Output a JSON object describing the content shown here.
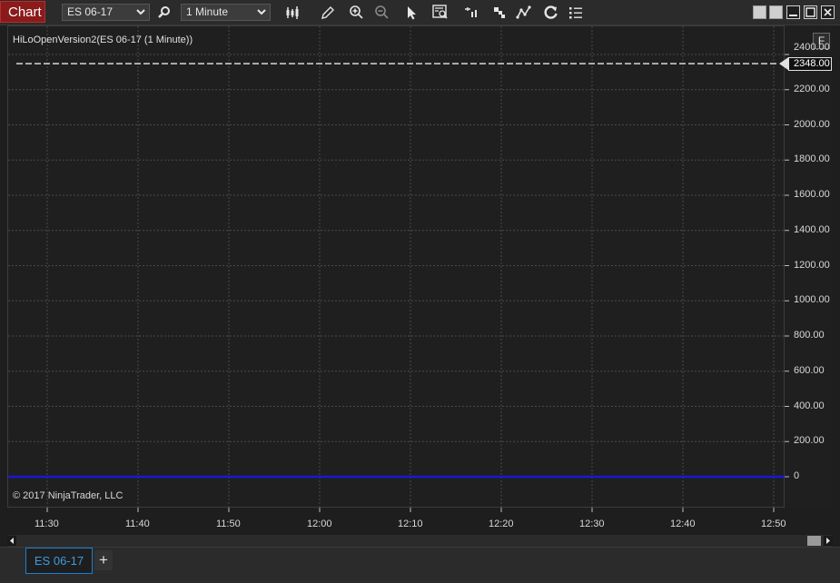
{
  "toolbar": {
    "chart_label": "Chart",
    "instrument": "ES 06-17",
    "interval": "1 Minute",
    "icons": [
      "magnifier-icon",
      "bars-type-icon",
      "pencil-icon",
      "zoom-in-icon",
      "zoom-out-icon",
      "pointer-icon",
      "data-box-icon",
      "bar-spacing-icon",
      "chart-style-icon",
      "strategy-icon",
      "reload-icon",
      "properties-list-icon"
    ]
  },
  "window_controls": [
    "tile-button",
    "tile-button-2",
    "minimize-button",
    "maximize-button",
    "close-button"
  ],
  "chart": {
    "indicator_label": "HiLoOpenVersion2(ES 06-17 (1 Minute))",
    "copyright": "© 2017 NinjaTrader, LLC",
    "f_button": "F",
    "price_marker": "2348.00",
    "colors": {
      "background": "#1f1f1f",
      "grid": "#4a4a4a",
      "zero_line": "#1818d8",
      "price_line": "#e8e8e8"
    }
  },
  "chart_data": {
    "type": "line",
    "y_ticks": [
      "2400.00",
      "2200.00",
      "2000.00",
      "1800.00",
      "1600.00",
      "1400.00",
      "1200.00",
      "1000.00",
      "800.00",
      "600.00",
      "400.00",
      "200.00",
      "0"
    ],
    "x_ticks": [
      "11:30",
      "11:40",
      "11:50",
      "12:00",
      "12:10",
      "12:20",
      "12:30",
      "12:40",
      "12:50"
    ],
    "ylim": [
      0,
      2400
    ],
    "series": [
      {
        "values": [
          2348,
          2348
        ]
      },
      {
        "values": [
          0,
          0
        ]
      }
    ]
  },
  "tabs": {
    "active": "ES 06-17",
    "add": "+"
  }
}
